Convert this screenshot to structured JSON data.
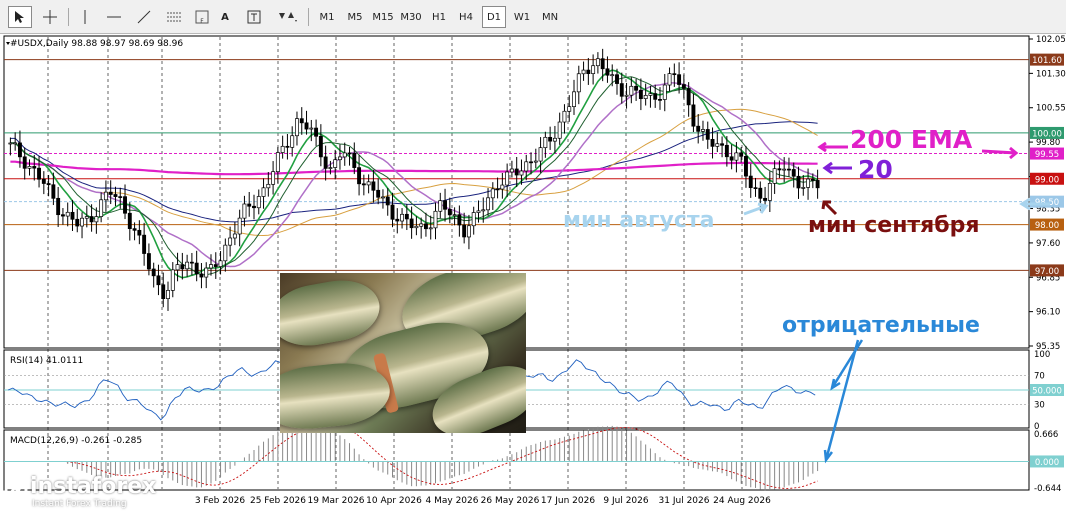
{
  "toolbar": {
    "timeframes": [
      "M1",
      "M5",
      "M15",
      "M30",
      "H1",
      "H4",
      "D1",
      "W1",
      "MN"
    ],
    "active_timeframe": "D1",
    "text_tool": "A"
  },
  "chart": {
    "header": "#USDX,Daily  98.88 98.97 98.69 98.96",
    "price_ticks": [
      "102.05",
      "101.30",
      "100.55",
      "99.80",
      "99.05",
      "98.35",
      "97.60",
      "96.85",
      "96.10",
      "95.35"
    ],
    "date_ticks": [
      "3 Feb 2026",
      "25 Feb 2026",
      "19 Mar 2026",
      "10 Apr 2026",
      "4 May 2026",
      "26 May 2026",
      "17 Jun 2026",
      "9 Jul 2026",
      "31 Jul 2026",
      "24 Aug 2026"
    ],
    "level_labels": [
      {
        "text": "101.60",
        "color": "#8b3a1a"
      },
      {
        "text": "100.00",
        "color": "#2e9a6e"
      },
      {
        "text": "99.55",
        "color": "#e020c8"
      },
      {
        "text": "99.00",
        "color": "#c81010"
      },
      {
        "text": "98.50",
        "color": "#9cc8e8"
      },
      {
        "text": "98.00",
        "color": "#b86010"
      },
      {
        "text": "97.00",
        "color": "#8b3a1a"
      }
    ]
  },
  "annotations": {
    "ema200": "200 EMA",
    "ma20": "20",
    "aug_low": "мин августа",
    "sep_low": "мин сентября",
    "negative": "отрицательные"
  },
  "rsi": {
    "label": "RSI(14) 41.0111",
    "ticks": [
      "100",
      "70",
      "50.000",
      "30",
      "0"
    ]
  },
  "macd": {
    "label": "MACD(12,26,9) -0.261 -0.285",
    "ticks": [
      "0.666",
      "0.000",
      "-0.644"
    ]
  },
  "watermark": {
    "brand": "instaforex",
    "tagline": "Instant Forex Trading"
  },
  "chart_data": {
    "type": "candlestick",
    "symbol": "#USDX",
    "timeframe": "Daily",
    "last_ohlc": {
      "open": 98.88,
      "high": 98.97,
      "low": 98.69,
      "close": 98.96
    },
    "ylim": [
      95.35,
      102.05
    ],
    "x_labels": [
      "3 Feb 2026",
      "25 Feb 2026",
      "19 Mar 2026",
      "10 Apr 2026",
      "4 May 2026",
      "26 May 2026",
      "17 Jun 2026",
      "9 Jul 2026",
      "31 Jul 2026",
      "24 Aug 2026"
    ],
    "close_path": [
      99.7,
      99.5,
      99.2,
      98.9,
      98.5,
      98.2,
      98.0,
      98.1,
      98.4,
      98.7,
      98.5,
      98.0,
      97.4,
      96.8,
      96.5,
      97.0,
      97.2,
      97.0,
      96.9,
      97.3,
      97.8,
      98.2,
      98.5,
      98.8,
      99.3,
      99.8,
      100.3,
      100.1,
      99.6,
      99.2,
      99.6,
      99.3,
      98.9,
      98.7,
      98.4,
      98.2,
      98.0,
      97.9,
      98.1,
      98.4,
      98.2,
      97.9,
      98.1,
      98.5,
      98.9,
      99.0,
      99.2,
      99.4,
      99.6,
      99.9,
      100.4,
      100.9,
      101.4,
      101.6,
      101.3,
      100.9,
      101.0,
      100.8,
      100.7,
      101.0,
      101.3,
      100.8,
      100.2,
      99.8,
      99.7,
      99.6,
      99.4,
      98.8,
      98.6,
      99.0,
      99.3,
      99.0,
      98.8,
      98.9
    ],
    "horizontal_levels": [
      101.6,
      100.0,
      99.55,
      99.0,
      98.5,
      98.0,
      97.0
    ],
    "rsi": {
      "period": 14,
      "value": 41.0111,
      "levels": [
        70,
        50,
        30
      ],
      "range": [
        0,
        100
      ]
    },
    "macd": {
      "fast": 12,
      "slow": 26,
      "signal": 9,
      "main": -0.261,
      "signal_value": -0.285,
      "range": [
        -0.644,
        0.666
      ]
    }
  }
}
